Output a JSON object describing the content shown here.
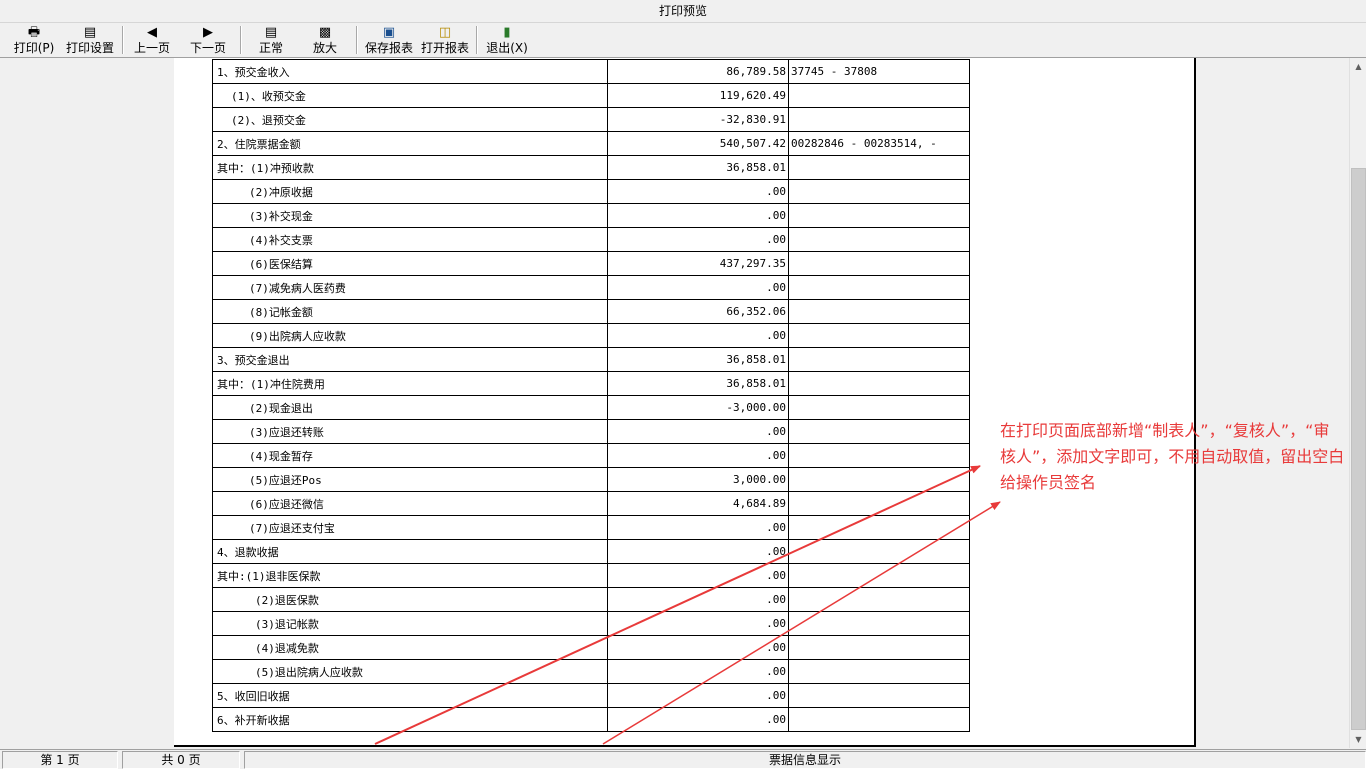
{
  "window": {
    "title": "打印预览"
  },
  "toolbar": {
    "print_label": "打印(P)",
    "print_setup_label": "打印设置",
    "prev_page_label": "上一页",
    "next_page_label": "下一页",
    "normal_label": "正常",
    "zoom_label": "放大",
    "save_report_label": "保存报表",
    "open_report_label": "打开报表",
    "exit_label": "退出(X)"
  },
  "icons": {
    "print": "printer-icon",
    "print_setup": "print-setup-icon",
    "prev": "left-triangle-icon",
    "next": "right-triangle-icon",
    "normal": "page-icon",
    "zoom": "magnifier-page-icon",
    "save": "floppy-disk-icon",
    "open": "open-folder-icon",
    "exit": "exit-door-icon"
  },
  "report": {
    "rows": [
      {
        "label": "1、预交金收入",
        "amount": "86,789.58",
        "note": "37745 - 37808"
      },
      {
        "label": "(1)、收预交金",
        "amount": "119,620.49",
        "note": ""
      },
      {
        "label": "(2)、退预交金",
        "amount": "-32,830.91",
        "note": ""
      },
      {
        "label": "2、住院票据金额",
        "amount": "540,507.42",
        "note": "00282846 - 00283514, -"
      },
      {
        "label": "其中：(1)冲预收款",
        "amount": "36,858.01",
        "note": ""
      },
      {
        "label": "(2)冲原收据",
        "amount": ".00",
        "note": ""
      },
      {
        "label": "(3)补交现金",
        "amount": ".00",
        "note": ""
      },
      {
        "label": "(4)补交支票",
        "amount": ".00",
        "note": ""
      },
      {
        "label": "(6)医保结算",
        "amount": "437,297.35",
        "note": ""
      },
      {
        "label": "(7)减免病人医药费",
        "amount": ".00",
        "note": ""
      },
      {
        "label": "(8)记帐金额",
        "amount": "66,352.06",
        "note": ""
      },
      {
        "label": "(9)出院病人应收款",
        "amount": ".00",
        "note": ""
      },
      {
        "label": "3、预交金退出",
        "amount": "36,858.01",
        "note": ""
      },
      {
        "label": "其中：(1)冲住院费用",
        "amount": "36,858.01",
        "note": ""
      },
      {
        "label": "(2)现金退出",
        "amount": "-3,000.00",
        "note": ""
      },
      {
        "label": "(3)应退还转账",
        "amount": ".00",
        "note": ""
      },
      {
        "label": "(4)现金暂存",
        "amount": ".00",
        "note": ""
      },
      {
        "label": "(5)应退还Pos",
        "amount": "3,000.00",
        "note": ""
      },
      {
        "label": "(6)应退还微信",
        "amount": "4,684.89",
        "note": ""
      },
      {
        "label": "(7)应退还支付宝",
        "amount": ".00",
        "note": ""
      },
      {
        "label": "4、退款收据",
        "amount": ".00",
        "note": ""
      },
      {
        "label": "其中:(1)退非医保款",
        "amount": ".00",
        "note": ""
      },
      {
        "label": "(2)退医保款",
        "amount": ".00",
        "note": ""
      },
      {
        "label": "(3)退记帐款",
        "amount": ".00",
        "note": ""
      },
      {
        "label": "(4)退减免款",
        "amount": ".00",
        "note": ""
      },
      {
        "label": "(5)退出院病人应收款",
        "amount": ".00",
        "note": ""
      },
      {
        "label": "5、收回旧收据",
        "amount": ".00",
        "note": ""
      },
      {
        "label": "6、补开新收据",
        "amount": ".00",
        "note": ""
      }
    ]
  },
  "annotation": {
    "text": "在打印页面底部新增“制表人”，“复核人”，“审核人”，添加文字即可，不用自动取值，留出空白给操作员签名",
    "color": "#e83a3a"
  },
  "statusbar": {
    "page_label": "第 1 页",
    "total_label": "共 0 页",
    "info_label": "票据信息显示"
  }
}
